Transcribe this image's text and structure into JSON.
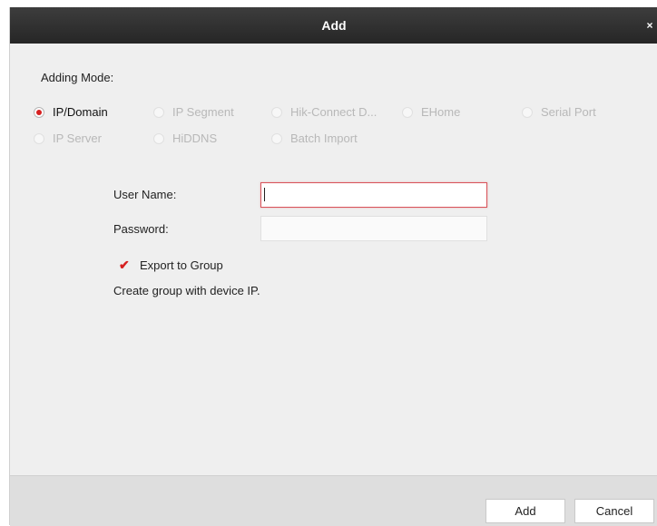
{
  "dialog": {
    "title": "Add",
    "close_icon": "×"
  },
  "adding_mode": {
    "label": "Adding Mode:",
    "options": [
      {
        "label": "IP/Domain",
        "selected": true
      },
      {
        "label": "IP Segment",
        "selected": false
      },
      {
        "label": "Hik-Connect D...",
        "selected": false
      },
      {
        "label": "EHome",
        "selected": false
      },
      {
        "label": "Serial Port",
        "selected": false
      },
      {
        "label": "IP Server",
        "selected": false
      },
      {
        "label": "HiDDNS",
        "selected": false
      },
      {
        "label": "Batch Import",
        "selected": false
      }
    ]
  },
  "form": {
    "username_label": "User Name:",
    "username_value": "",
    "password_label": "Password:",
    "password_value": "",
    "export_to_group_label": "Export to Group",
    "export_to_group_checked": true,
    "check_glyph": "✔",
    "hint": "Create group with device IP."
  },
  "footer": {
    "add_label": "Add",
    "cancel_label": "Cancel"
  },
  "colors": {
    "title_bar": "#2e2e2e",
    "accent": "#d62020",
    "focus_border": "#d9535a",
    "panel_bg": "#efefef",
    "footer_bg": "#dedede"
  }
}
